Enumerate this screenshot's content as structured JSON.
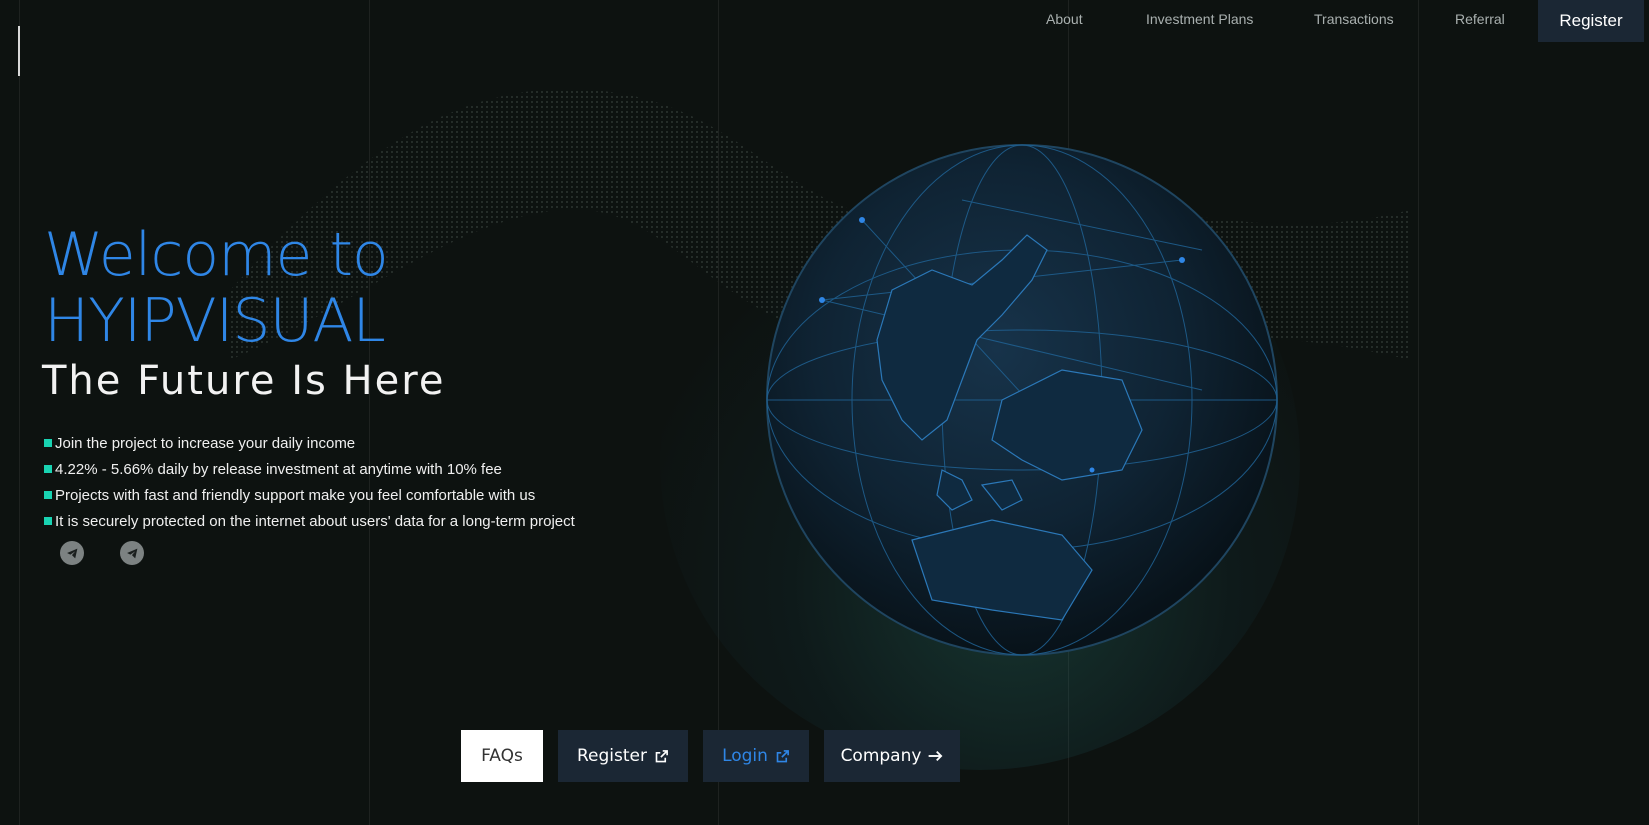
{
  "nav": {
    "items": [
      "About",
      "Investment Plans",
      "Transactions",
      "Referral"
    ],
    "register_label": "Register"
  },
  "hero": {
    "title_line1": "Welcome to",
    "title_line2": "HYIPVISUAL",
    "subtitle": "The Future Is Here",
    "bullets": [
      "Join the project to increase your daily income",
      "4.22% - 5.66% daily by release investment at anytime with 10% fee",
      "Projects with fast and friendly support make you feel comfortable with us",
      "It is securely protected on the internet about users' data for a long-term project"
    ],
    "socials": [
      "telegram-icon",
      "telegram-icon"
    ]
  },
  "buttons": {
    "faqs": "FAQs",
    "register": "Register",
    "login": "Login",
    "company": "Company"
  },
  "colors": {
    "background": "#0d1210",
    "accent_blue": "#2f86e6",
    "bullet_teal": "#19d3b2",
    "button_dark": "#1b2734"
  }
}
